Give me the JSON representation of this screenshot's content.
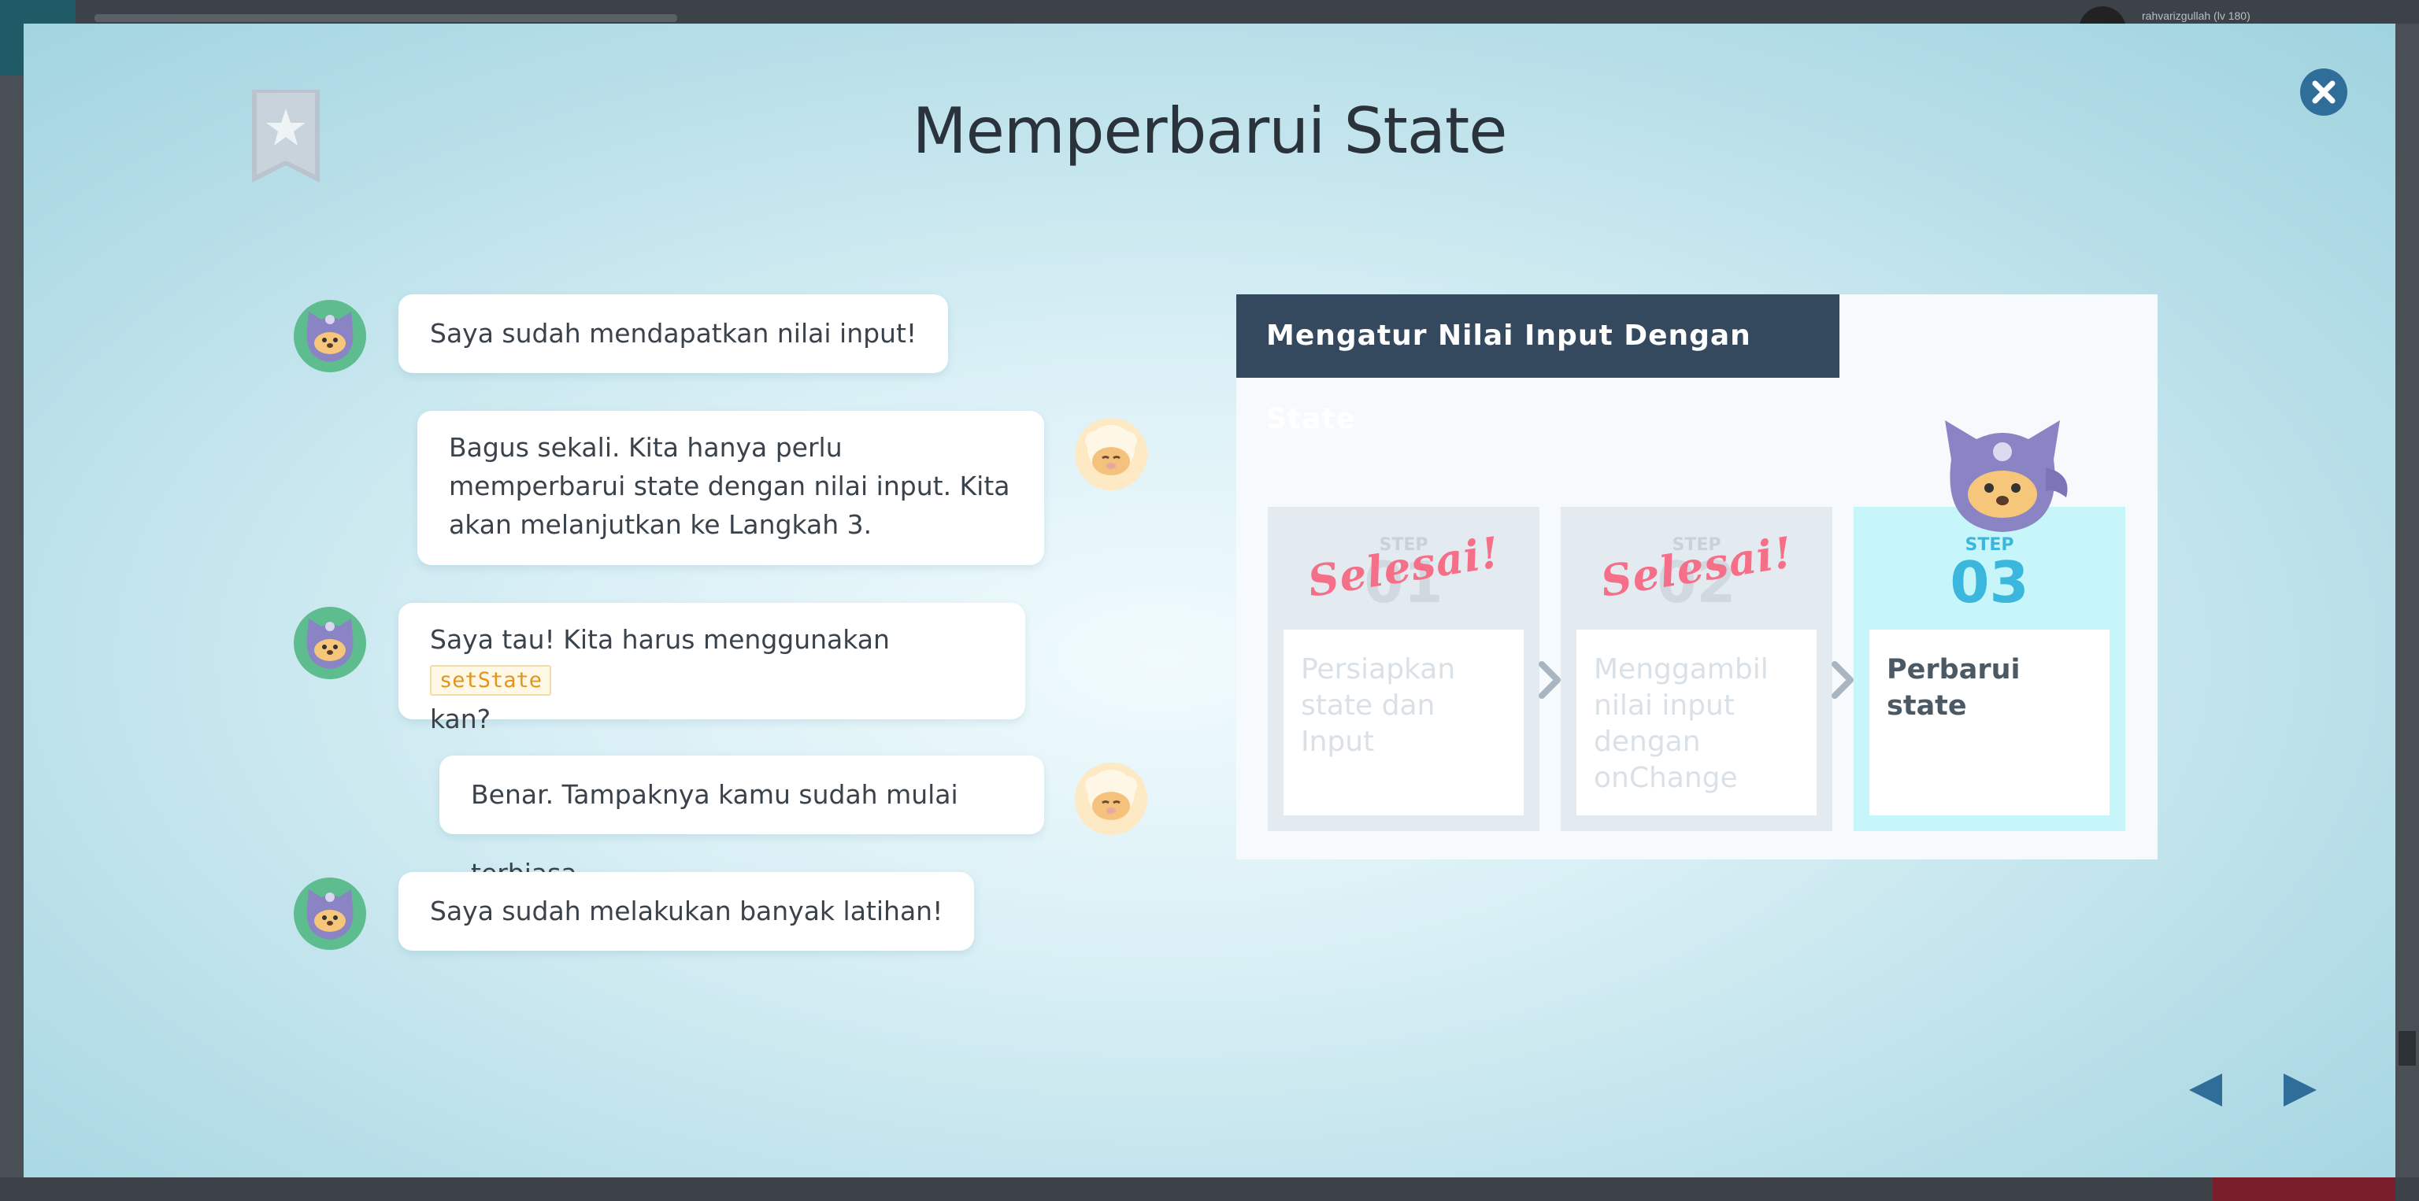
{
  "background": {
    "user_label": "rahvarizgullah (lv 180)"
  },
  "modal": {
    "title": "Memperbarui State"
  },
  "chat": [
    {
      "speaker": "ninja",
      "text": "Saya sudah mendapatkan nilai input!"
    },
    {
      "speaker": "sheep",
      "text": "Bagus sekali. Kita hanya perlu memperbarui state dengan nilai input. Kita akan melanjutkan ke Langkah 3."
    },
    {
      "speaker": "ninja",
      "text_before": "Saya tau! Kita harus menggunakan",
      "code": "setState",
      "text_after": "kan?"
    },
    {
      "speaker": "sheep",
      "text": "Benar. Tampaknya kamu sudah mulai terbiasa."
    },
    {
      "speaker": "ninja",
      "text": "Saya sudah melakukan banyak latihan!"
    }
  ],
  "panel": {
    "title": "Mengatur Nilai Input Dengan State",
    "steps": [
      {
        "label": "STEP",
        "number": "01",
        "desc": "Persiapkan state dan Input",
        "stamp": "Selesai!",
        "done": true
      },
      {
        "label": "STEP",
        "number": "02",
        "desc": "Menggambil nilai input dengan onChange",
        "stamp": "Selesai!",
        "done": true
      },
      {
        "label": "STEP",
        "number": "03",
        "desc": "Perbarui state",
        "stamp": "",
        "done": false
      }
    ]
  },
  "icons": {
    "bookmark": "bookmark-star-icon",
    "close": "close-icon",
    "prev": "prev-arrow-icon",
    "next": "next-arrow-icon"
  },
  "colors": {
    "accent": "#2f6e98",
    "header": "#34485e",
    "stamp": "#f56f88",
    "active_step": "#c6f6fa"
  }
}
